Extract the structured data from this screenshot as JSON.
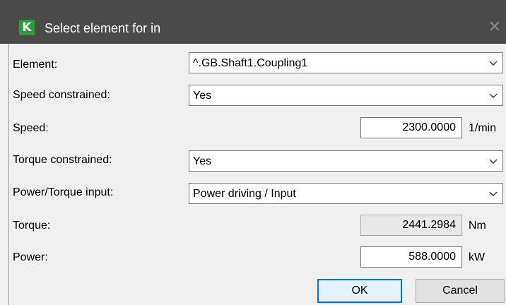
{
  "window": {
    "app_icon_letter": "K",
    "title": "Select element for in",
    "close_glyph": "✕"
  },
  "form": {
    "element": {
      "label": "Element:",
      "value": "^.GB.Shaft1.Coupling1"
    },
    "speed_constrained": {
      "label": "Speed constrained:",
      "value": "Yes"
    },
    "speed": {
      "label": "Speed:",
      "value": "2300.0000",
      "unit": "1/min"
    },
    "torque_constrained": {
      "label": "Torque constrained:",
      "value": "Yes"
    },
    "power_torque_input": {
      "label": "Power/Torque input:",
      "value": "Power driving / Input"
    },
    "torque": {
      "label": "Torque:",
      "value": "2441.2984",
      "unit": "Nm"
    },
    "power": {
      "label": "Power:",
      "value": "588.0000",
      "unit": "kW"
    }
  },
  "buttons": {
    "ok": "OK",
    "cancel": "Cancel"
  },
  "icons": {
    "dropdown": "chevron-down-icon",
    "close": "close-icon",
    "app": "app-logo-icon"
  },
  "colors": {
    "titlebar": "#4a4a4a",
    "app_icon": "#2e9a3c",
    "default_button_border": "#0078d7"
  }
}
